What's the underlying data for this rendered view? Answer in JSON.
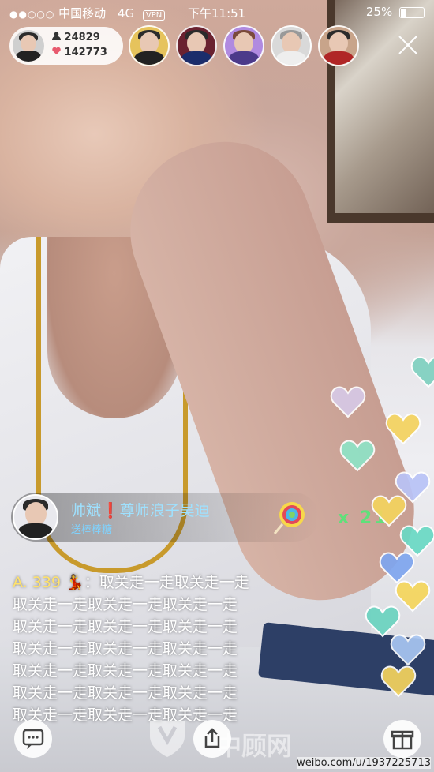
{
  "status_bar": {
    "signal": "●●○○○",
    "carrier": "中国移动",
    "network": "4G",
    "vpn": "VPN",
    "time": "下午11:51",
    "battery": "25%",
    "battery_level": 0.25
  },
  "host": {
    "followers": "24829",
    "likes": "142773"
  },
  "gift": {
    "sender": "帅斌❗尊师浪子吴迪",
    "action": "送棒棒糖",
    "combo": "x 21"
  },
  "chat": {
    "user": "A. 339",
    "user_icon": "dancer",
    "messages": [
      "：取关走一走取关走一走",
      "取关走一走取关走一走取关走一走",
      "取关走一走取关走一走取关走一走",
      "取关走一走取关走一走取关走一走",
      "取关走一走取关走一走取关走一走",
      "取关走一走取关走一走取关走一走",
      "取关走一走取关走一走取关走一走"
    ]
  },
  "watermark": {
    "brand": "中顾网",
    "credit": "weibo.com/u/1937225713"
  },
  "colors": {
    "gift_name": "#9ee1ff",
    "combo": "#5fe07a",
    "chat_user": "#ffe26b"
  },
  "icons": [
    "person-icon",
    "heart-icon",
    "close-icon",
    "lollipop-icon",
    "chat-icon",
    "share-icon",
    "gift-icon"
  ]
}
